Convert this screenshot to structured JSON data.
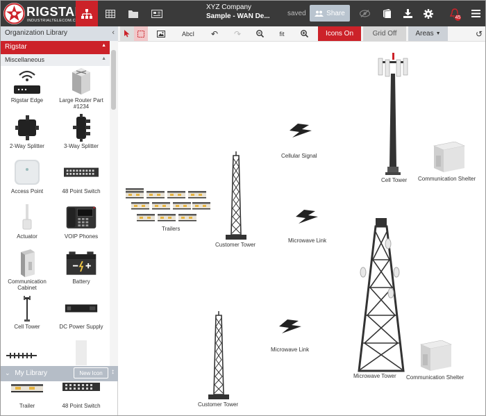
{
  "brand": {
    "name": "RIGSTAR",
    "sub": "INDUSTRIALTELECOM.COM",
    "accent": "#cc2229"
  },
  "header": {
    "company": "XYZ Company",
    "document": "Sample - WAN De...",
    "status": "saved",
    "share_label": "Share",
    "notification_count": "45"
  },
  "topnav_icons": [
    "sitemap-icon",
    "table-icon",
    "folder-icon",
    "newspaper-icon"
  ],
  "right_icons": [
    "eye-slash-icon",
    "book-icon",
    "download-icon",
    "gear-icon",
    "bell-icon",
    "menu-icon"
  ],
  "sidebar": {
    "title": "Organization Library",
    "category": "Rigstar",
    "section": "Miscellaneous",
    "items": [
      {
        "label": "Rigstar Edge",
        "icon": "router-icon"
      },
      {
        "label": "Large Router Part #1234",
        "icon": "large-router-icon"
      },
      {
        "label": "2-Way Splitter",
        "icon": "splitter-2way-icon"
      },
      {
        "label": "3-Way Splitter",
        "icon": "splitter-3way-icon"
      },
      {
        "label": "Access Point",
        "icon": "access-point-icon"
      },
      {
        "label": "48 Point Switch",
        "icon": "switch-icon"
      },
      {
        "label": "Actuator",
        "icon": "actuator-icon"
      },
      {
        "label": "VOIP Phones",
        "icon": "phone-icon"
      },
      {
        "label": "Communication Cabinet",
        "icon": "cabinet-icon"
      },
      {
        "label": "Battery",
        "icon": "battery-icon"
      },
      {
        "label": "Cell Tower",
        "icon": "cell-tower-icon"
      },
      {
        "label": "DC Power Supply",
        "icon": "power-supply-icon"
      }
    ],
    "my_library": {
      "title": "My Library",
      "new_icon_label": "New Icon",
      "items": [
        {
          "label": "Trailer"
        },
        {
          "label": "48 Point Switch"
        }
      ]
    }
  },
  "toolbar": {
    "text_tool": "AbcI",
    "fit": "fit",
    "icons_on": "Icons On",
    "grid_off": "Grid Off",
    "areas": "Areas"
  },
  "canvas": {
    "labels": {
      "trailers": "Trailers",
      "customer_tower_1": "Customer Tower",
      "cellular_signal": "Cellular Signal",
      "microwave_link_1": "Microwave Link",
      "cell_tower": "Cell Tower",
      "shelter_1": "Communication Shelter",
      "microwave_tower": "Microwave Tower",
      "microwave_link_2": "Microwave Link",
      "shelter_2": "Communication Shelter",
      "customer_tower_2": "Customer Tower"
    }
  }
}
